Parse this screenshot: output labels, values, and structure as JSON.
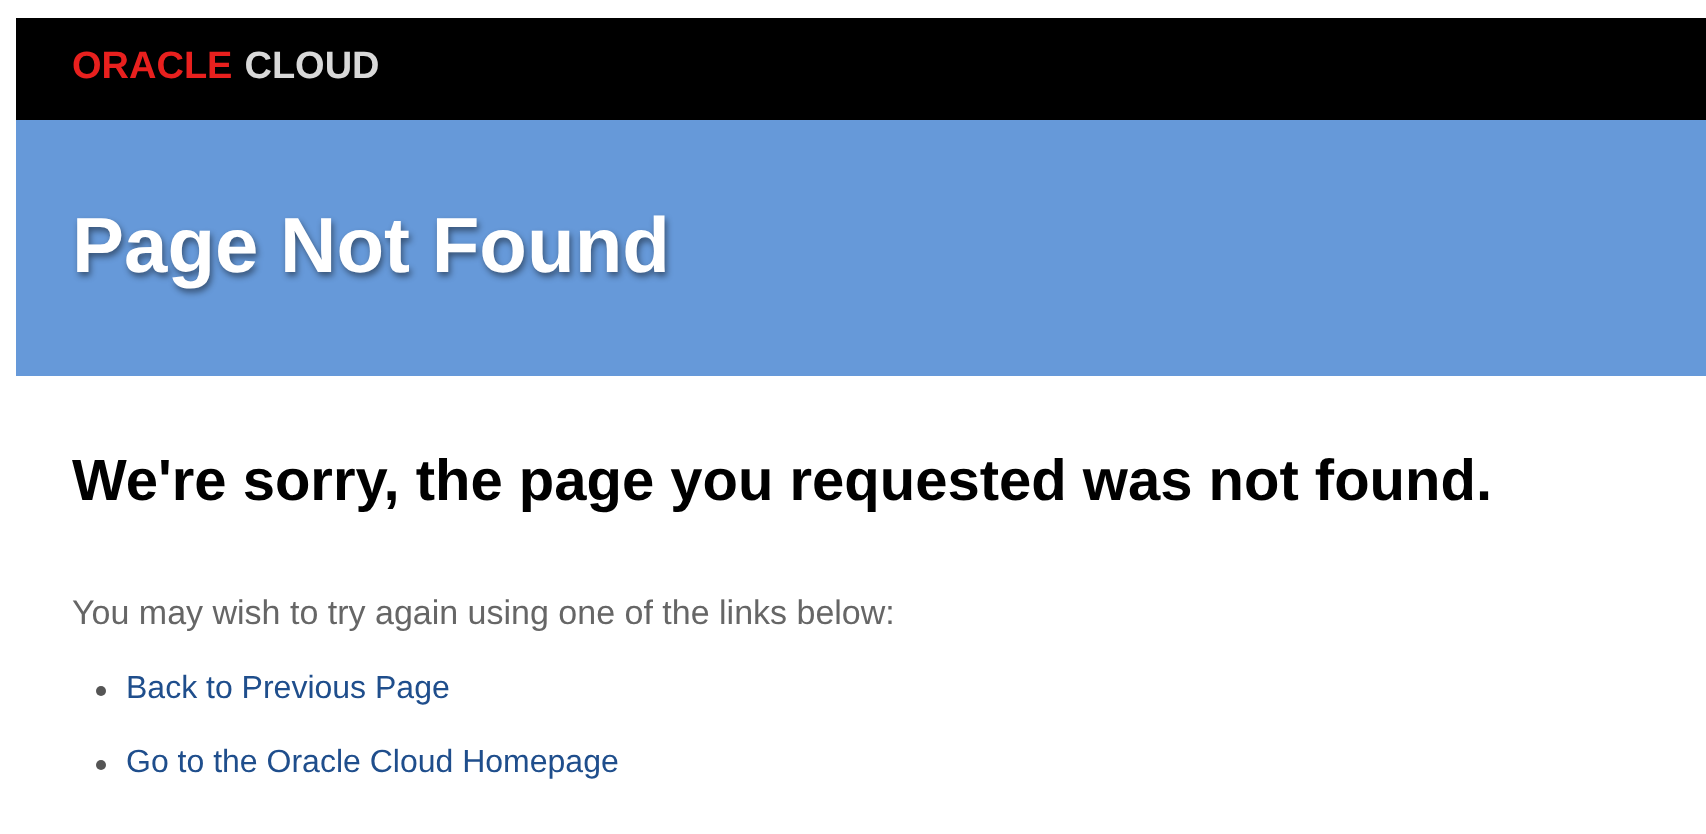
{
  "header": {
    "brand": "ORACLE",
    "product": "CLOUD"
  },
  "banner": {
    "title": "Page Not Found"
  },
  "content": {
    "heading": "We're sorry, the page you requested was not found.",
    "intro": "You may wish to try again using one of the links below:",
    "links": [
      "Back to Previous Page",
      "Go to the Oracle Cloud Homepage"
    ]
  }
}
